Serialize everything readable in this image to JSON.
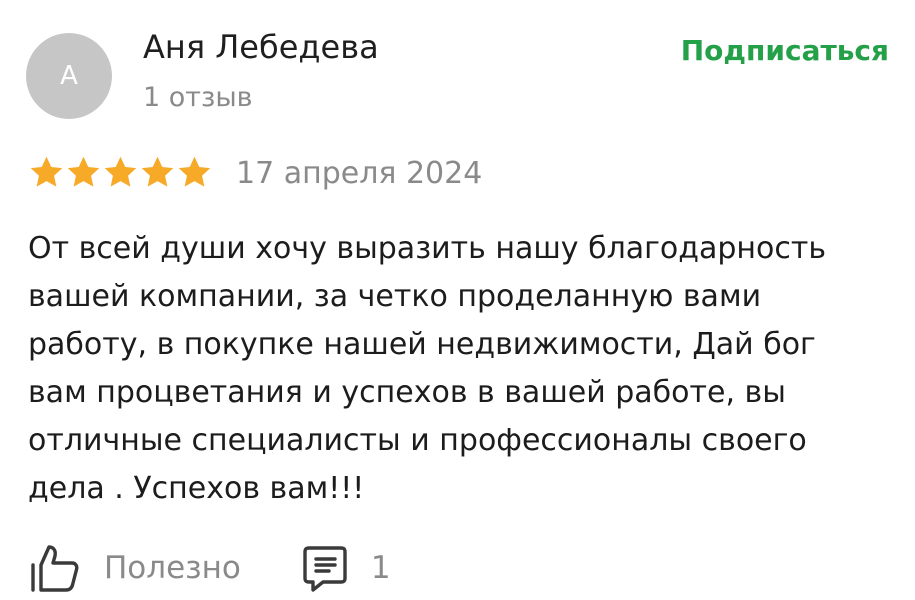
{
  "author": {
    "initial": "А",
    "name": "Аня Лебедева",
    "review_count": "1 отзыв"
  },
  "subscribe_label": "Подписаться",
  "review": {
    "rating": 5,
    "rating_max": 5,
    "date": "17 апреля 2024",
    "text_lines": [
      "От всей души хочу выразить нашу благодарность",
      "вашей компании, за четко проделанную вами",
      "работу, в покупке нашей недвижимости, Дай бог",
      "вам процветания и успехов в вашей работе, вы",
      "отличные специалисты и профессионалы своего",
      "дела . Успехов вам!!!"
    ]
  },
  "actions": {
    "like_label": "Полезно",
    "like_icon": "thumbs-up-icon",
    "comment_icon": "comment-icon",
    "comment_count": "1"
  },
  "colors": {
    "accent": "#24a148",
    "star": "#f7a928",
    "muted": "#8a8a8a",
    "avatar_bg": "#c6c6c6"
  }
}
